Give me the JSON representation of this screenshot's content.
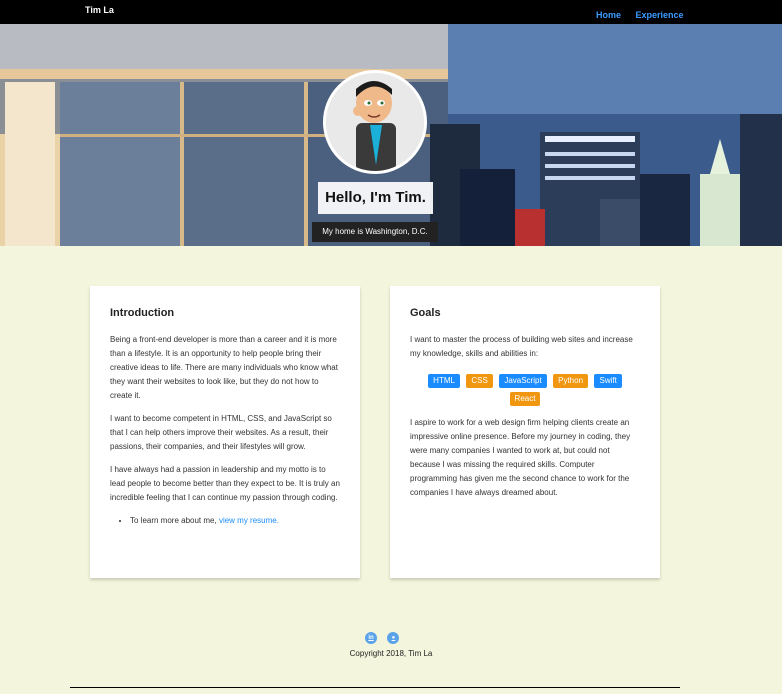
{
  "nav": {
    "brand": "Tim La",
    "links": [
      "Home",
      "Experience"
    ]
  },
  "hero": {
    "title": "Hello, I'm Tim.",
    "subtitle": "My home is Washington, D.C."
  },
  "intro": {
    "heading": "Introduction",
    "paragraphs": [
      "Being a front-end developer is more than a career and it is more than a lifestyle. It is an opportunity to help people bring their creative ideas to life. There are many individuals who know what they want their websites to look like, but they do not how to create it.",
      "I want to become competent in HTML, CSS, and JavaScript so that I can help others improve their websites. As a result, their passions, their companies, and their lifestyles will grow.",
      "I have always had a passion in leadership and my motto is to lead people to become better than they expect to be. It is truly an incredible feeling that I can continue my passion through coding."
    ],
    "bullet_text": "To learn more about me, ",
    "bullet_link": "view my resume."
  },
  "goals": {
    "heading": "Goals",
    "lead": "I want to master the process of building web sites and increase my knowledge, skills and abilities in:",
    "skills": [
      {
        "label": "HTML",
        "color": "#1a8cff"
      },
      {
        "label": "CSS",
        "color": "#f0960f"
      },
      {
        "label": "JavaScript",
        "color": "#1a8cff"
      },
      {
        "label": "Python",
        "color": "#f0960f"
      },
      {
        "label": "Swift",
        "color": "#1a8cff"
      },
      {
        "label": "React",
        "color": "#f0960f"
      }
    ],
    "body": "I aspire to work for a web design firm helping clients create an impressive online presence. Before my journey in coding, they were many companies I wanted to work at, but could not because I was missing the required skills. Computer programming has given me the second chance to work for the companies I have always dreamed about."
  },
  "footer": {
    "icons": [
      "linkedin-icon",
      "github-icon"
    ],
    "copyright": "Copyright 2018, Tim La"
  }
}
